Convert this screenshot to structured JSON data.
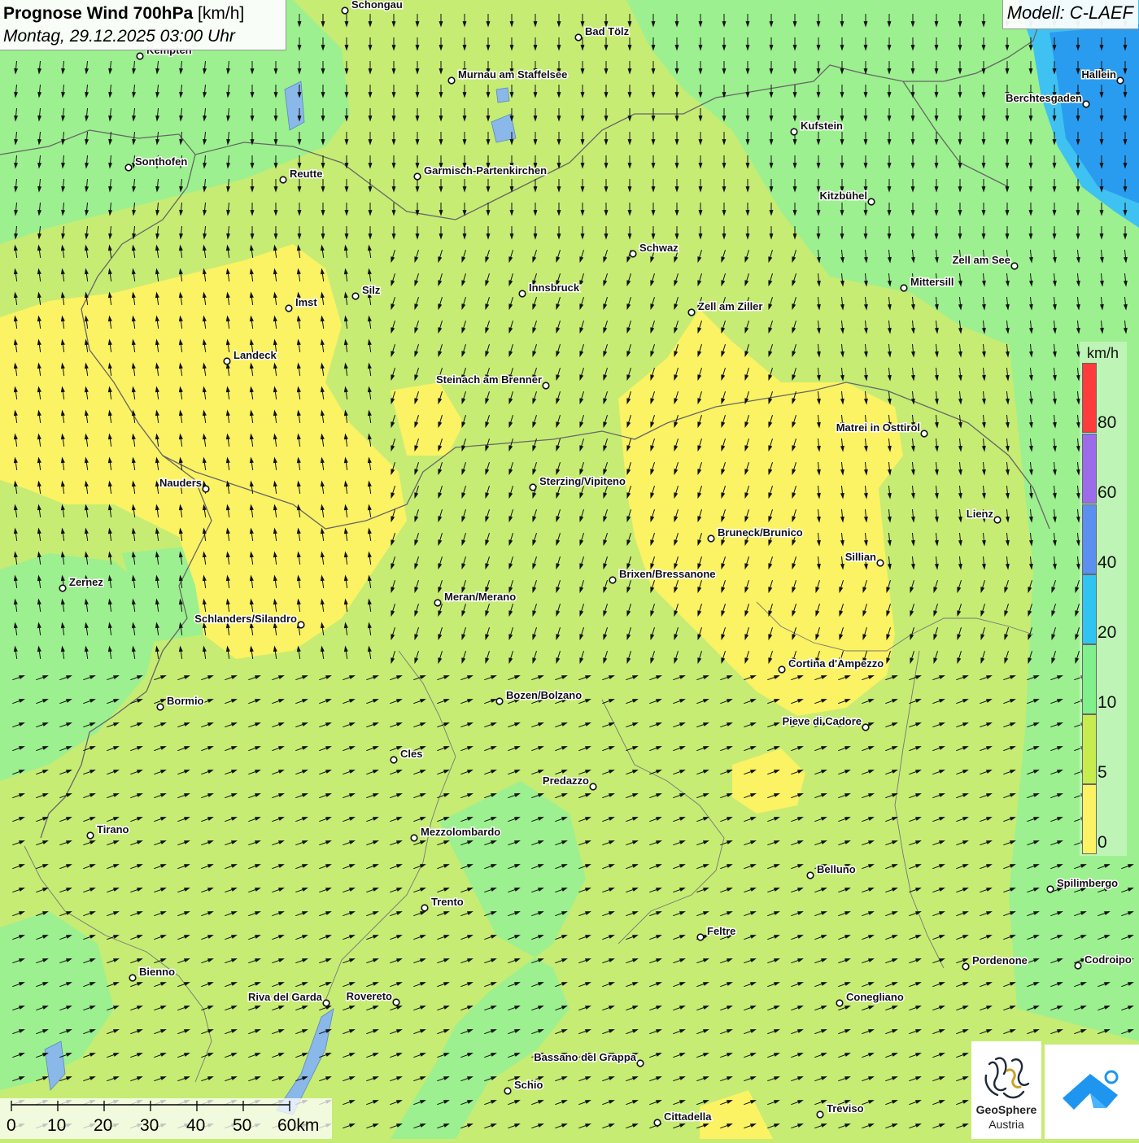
{
  "header": {
    "title_bold": "Prognose Wind 700hPa",
    "title_unit": "[km/h]",
    "datetime": "Montag, 29.12.2025 03:00 Uhr"
  },
  "model": {
    "label": "Modell: C-LAEF"
  },
  "legend": {
    "unit": "km/h",
    "ticks": [
      "80",
      "60",
      "40",
      "20",
      "10",
      "5",
      "0"
    ],
    "colors": [
      "#ff3b3b",
      "#9b6bea",
      "#5b8ff0",
      "#2fc4f2",
      "#7ff08c",
      "#c6ec4e",
      "#fbf264"
    ]
  },
  "scale_bar": {
    "labels": [
      "0",
      "10",
      "20",
      "30",
      "40",
      "50",
      "60km"
    ]
  },
  "cities": [
    {
      "name": "Schongau"
    },
    {
      "name": "Bad Tölz"
    },
    {
      "name": "Kempten"
    },
    {
      "name": "Murnau am Staffelsee"
    },
    {
      "name": "Hallein"
    },
    {
      "name": "Berchtesgaden"
    },
    {
      "name": "Kufstein"
    },
    {
      "name": "Sonthofen"
    },
    {
      "name": "Reutte"
    },
    {
      "name": "Garmisch-Partenkirchen"
    },
    {
      "name": "Kitzbühel"
    },
    {
      "name": "Schwaz"
    },
    {
      "name": "Zell am See"
    },
    {
      "name": "Mittersill"
    },
    {
      "name": "Silz"
    },
    {
      "name": "Innsbruck"
    },
    {
      "name": "Imst"
    },
    {
      "name": "Zell am Ziller"
    },
    {
      "name": "Landeck"
    },
    {
      "name": "Steinach am Brenner"
    },
    {
      "name": "Matrei in Osttirol"
    },
    {
      "name": "Nauders"
    },
    {
      "name": "Sterzing/Vipiteno"
    },
    {
      "name": "Lienz"
    },
    {
      "name": "Bruneck/Brunico"
    },
    {
      "name": "Sillian"
    },
    {
      "name": "Zernez"
    },
    {
      "name": "Brixen/Bressanone"
    },
    {
      "name": "Meran/Merano"
    },
    {
      "name": "Schlanders/Silandro"
    },
    {
      "name": "Cortina d'Ampezzo"
    },
    {
      "name": "Bozen/Bolzano"
    },
    {
      "name": "Bormio"
    },
    {
      "name": "Pieve di Cadore"
    },
    {
      "name": "Cles"
    },
    {
      "name": "Predazzo"
    },
    {
      "name": "Tirano"
    },
    {
      "name": "Mezzolombardo"
    },
    {
      "name": "Belluno"
    },
    {
      "name": "Spilimbergo"
    },
    {
      "name": "Trento"
    },
    {
      "name": "Feltre"
    },
    {
      "name": "Pordenone"
    },
    {
      "name": "Codroipo"
    },
    {
      "name": "Bienno"
    },
    {
      "name": "Riva del Garda"
    },
    {
      "name": "Rovereto"
    },
    {
      "name": "Conegliano"
    },
    {
      "name": "Bassano del Grappa"
    },
    {
      "name": "Schio"
    },
    {
      "name": "Treviso"
    },
    {
      "name": "Cittadella"
    }
  ],
  "logos": {
    "geosphere_line1": "GeoSphere",
    "geosphere_line2": "Austria"
  },
  "colors": {
    "calm": "#fbf264",
    "light": "#c6ec4e",
    "moderate": "#9cf08f",
    "strong": "#2fc4f2",
    "strongest": "#1e9cf0"
  }
}
